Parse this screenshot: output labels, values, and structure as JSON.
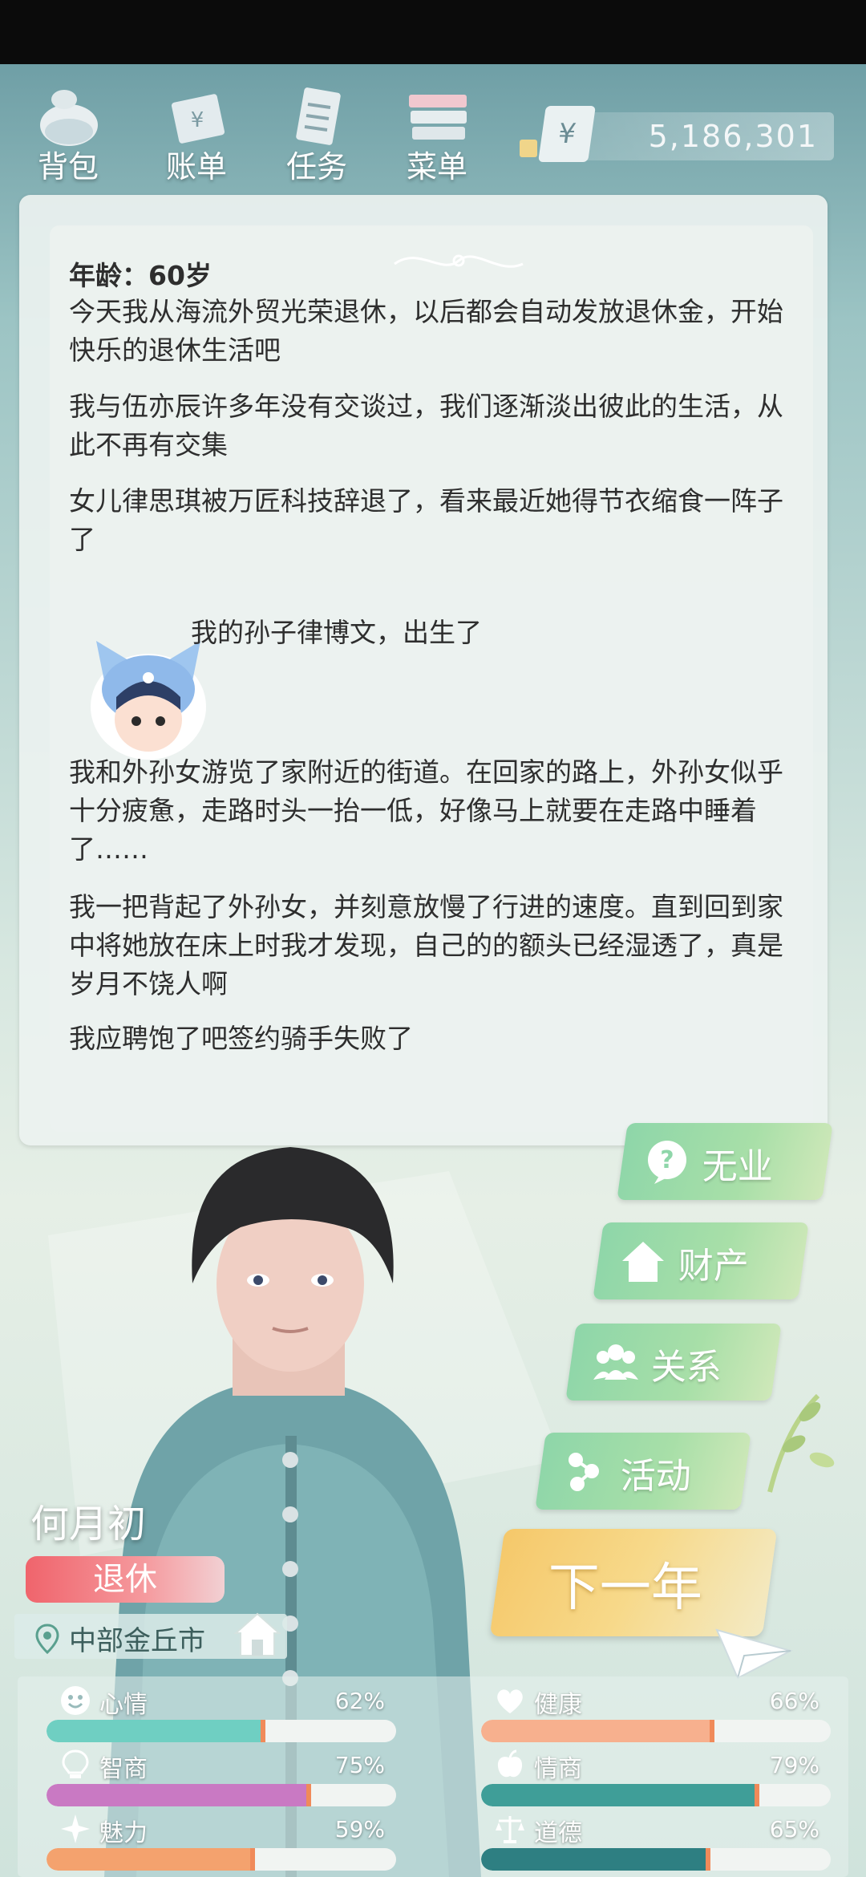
{
  "nav": {
    "items": [
      {
        "label": "背包",
        "icon": "backpack-icon"
      },
      {
        "label": "账单",
        "icon": "bill-icon"
      },
      {
        "label": "任务",
        "icon": "task-list-icon"
      },
      {
        "label": "菜单",
        "icon": "menu-cards-icon"
      }
    ]
  },
  "money": {
    "currency_symbol": "¥",
    "amount": "5,186,301"
  },
  "story": {
    "age_line": "年龄：60岁",
    "paragraphs": [
      "今天我从海流外贸光荣退休，以后都会自动发放退休金，开始快乐的退休生活吧",
      "我与伍亦辰许多年没有交谈过，我们逐渐淡出彼此的生活，从此不再有交集",
      "女儿律思琪被万匠科技辞退了，看来最近她得节衣缩食一阵子了",
      "我的孙子律博文，出生了",
      "我和外孙女游览了家附近的街道。在回家的路上，外孙女似乎十分疲惫，走路时头一抬一低，好像马上就要在走路中睡着了……",
      "我一把背起了外孙女，并刻意放慢了行进的速度。直到回到家中将她放在床上时我才发现，自己的的额头已经湿透了，真是岁月不饶人啊",
      "我应聘饱了吧签约骑手失败了"
    ]
  },
  "character": {
    "name": "何月初",
    "status": "退休",
    "location": "中部金丘市"
  },
  "actions": {
    "job": "无业",
    "property": "财产",
    "relations": "关系",
    "activities": "活动",
    "next_year": "下一年"
  },
  "stats": [
    {
      "label": "心情",
      "value": "62%",
      "level": 0.62,
      "icon": "smiley-icon",
      "color": "#6fcfc2"
    },
    {
      "label": "健康",
      "value": "66%",
      "level": 0.66,
      "icon": "heart-icon",
      "color": "#f7b08e"
    },
    {
      "label": "智商",
      "value": "75%",
      "level": 0.75,
      "icon": "lightbulb-brain-icon",
      "color": "#c979c3"
    },
    {
      "label": "情商",
      "value": "79%",
      "level": 0.79,
      "icon": "apple-icon",
      "color": "#3f9e98"
    },
    {
      "label": "魅力",
      "value": "59%",
      "level": 0.59,
      "icon": "sparkle-icon",
      "color": "#f4a26e"
    },
    {
      "label": "道德",
      "value": "65%",
      "level": 0.65,
      "icon": "scales-icon",
      "color": "#2e7f82"
    }
  ],
  "colors": {
    "marker": "#f08a5a",
    "panel": "#ecf2f0",
    "action_green": "#8ed6a9",
    "next_year_gold": "#f5c86a",
    "status_red": "#f0646c"
  }
}
